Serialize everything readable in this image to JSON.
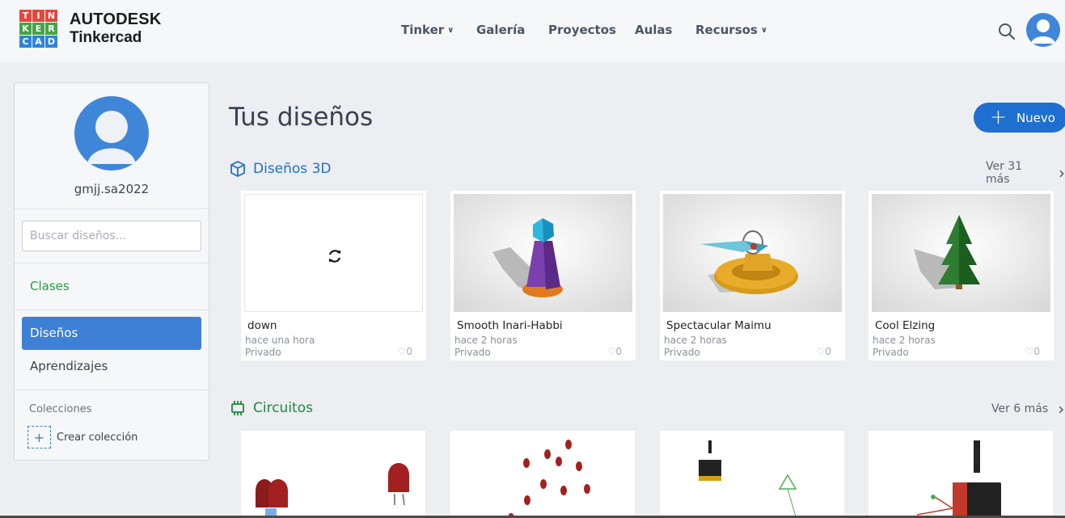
{
  "header": {
    "logo_letters": [
      "T",
      "I",
      "N",
      "K",
      "E",
      "R",
      "C",
      "A",
      "D"
    ],
    "logo_colors": [
      "#e3483e",
      "#e3483e",
      "#e3483e",
      "#45a446",
      "#45a446",
      "#45a446",
      "#2f84d8",
      "#2f84d8",
      "#2f84d8"
    ],
    "brand_top": "AUTODESK",
    "brand_bottom": "Tinkercad",
    "nav": [
      {
        "label": "Tinker",
        "dropdown": true
      },
      {
        "label": "Galería",
        "dropdown": false
      },
      {
        "label": "Proyectos",
        "dropdown": false
      },
      {
        "label": "Aulas",
        "dropdown": false
      },
      {
        "label": "Recursos",
        "dropdown": true
      }
    ],
    "search_icon": "search-icon",
    "avatar_icon": "user-avatar-icon"
  },
  "sidebar": {
    "username": "gmjj.sa2022",
    "search_placeholder": "Buscar diseños...",
    "classes_label": "Clases",
    "designs_label": "Diseños",
    "learning_label": "Aprendizajes",
    "collections_label": "Colecciones",
    "create_collection_label": "Crear colección"
  },
  "main": {
    "title": "Tus diseños",
    "new_button_label": "Nuevo",
    "designs3d": {
      "label": "Diseños 3D",
      "see_more": "Ver 31 más",
      "cards": [
        {
          "name": "down",
          "time": "hace una hora",
          "visibility": "Privado",
          "likes": "0"
        },
        {
          "name": "Smooth Inari-Habbi",
          "time": "hace 2 horas",
          "visibility": "Privado",
          "likes": "0"
        },
        {
          "name": "Spectacular Maimu",
          "time": "hace 2 horas",
          "visibility": "Privado",
          "likes": "0"
        },
        {
          "name": "Cool Elzing",
          "time": "hace 2 horas",
          "visibility": "Privado",
          "likes": "0"
        }
      ]
    },
    "circuits": {
      "label": "Circuitos",
      "see_more": "Ver 6 más"
    }
  },
  "colors": {
    "accent_blue": "#1e6fd0",
    "active_blue": "#3d80d6",
    "green": "#20a040"
  }
}
